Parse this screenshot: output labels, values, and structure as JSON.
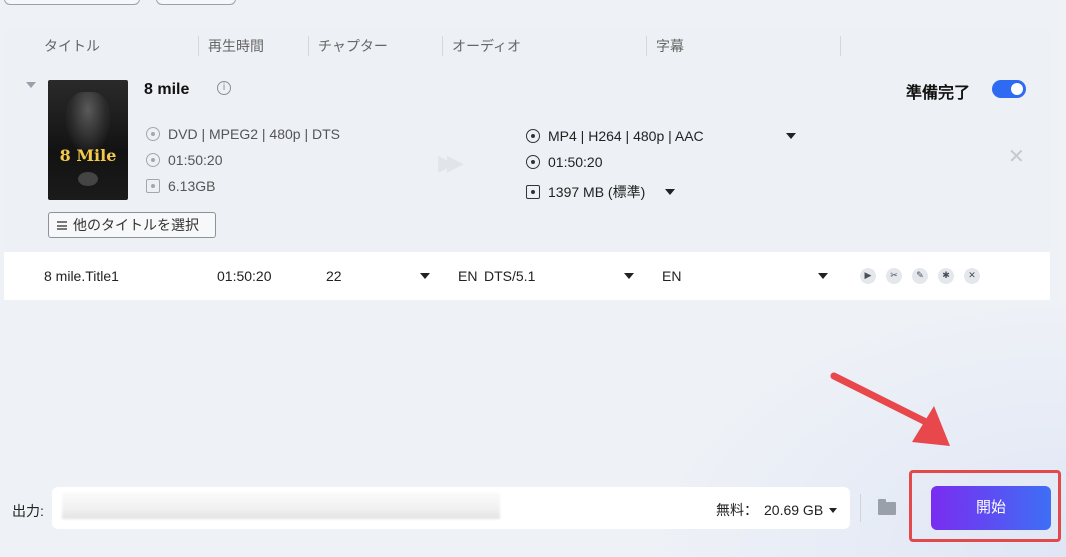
{
  "columns": [
    "タイトル",
    "再生時間",
    "チャプター",
    "オーディオ",
    "字幕"
  ],
  "item": {
    "title": "8 mile",
    "poster_text": "8 Mile",
    "ready_label": "準備完了",
    "ready_on": true,
    "source": {
      "format": "DVD | MPEG2 | 480p | DTS",
      "duration": "01:50:20",
      "size": "6.13GB"
    },
    "output": {
      "format": "MP4 | H264 | 480p | AAC",
      "duration": "01:50:20",
      "size": "1397 MB (標準)"
    },
    "select_title_button": "他のタイトルを選択"
  },
  "title_row": {
    "name": "8 mile.Title1",
    "duration": "01:50:20",
    "chapters": "22",
    "audio_lang": "EN",
    "audio_codec": "DTS/5.1",
    "subtitle": "EN",
    "actions": [
      "play-icon",
      "cut-icon",
      "edit-icon",
      "effect-icon",
      "delete-icon"
    ]
  },
  "bottom": {
    "output_label": "出力:",
    "free_label": "無料：",
    "free_space": "20.69 GB",
    "start_button": "開始"
  },
  "colors": {
    "accent": "#2f6bf2",
    "start_gradient_from": "#7a2cf0",
    "start_gradient_to": "#3e6ff5",
    "highlight": "#e2494a"
  }
}
